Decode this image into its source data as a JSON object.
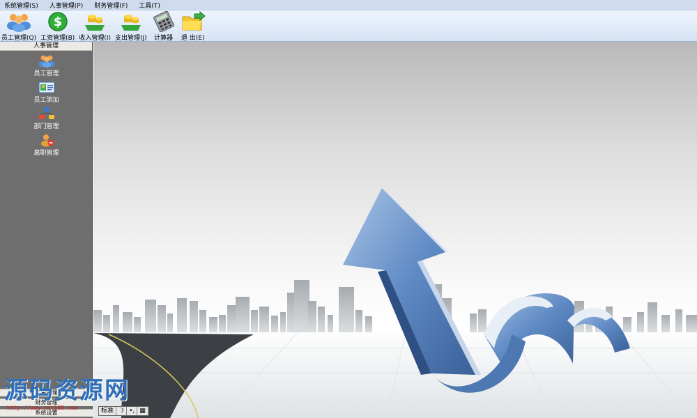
{
  "menu": [
    "系统管理(S)",
    "人事管理(P)",
    "财务管理(F)",
    "工具(T)"
  ],
  "toolbar": {
    "employee": "员工管理(Q)",
    "salary": "工资管理(B)",
    "income": "收入管理(I)",
    "expense": "支出管理(J)",
    "calculator": "计算器",
    "exit": "退 出(E)"
  },
  "sidebar": {
    "header": "人事管理",
    "items": [
      {
        "label": "员工管理",
        "icon": "users-icon"
      },
      {
        "label": "员工添加",
        "icon": "id-card-icon"
      },
      {
        "label": "部门管理",
        "icon": "org-chart-icon"
      },
      {
        "label": "离职管理",
        "icon": "user-remove-icon"
      }
    ],
    "bottom": [
      "工资管理",
      "财务管理",
      "系统设置"
    ]
  },
  "watermark": {
    "text": "源码资源网",
    "url": "http://www.net188.com"
  },
  "ime": [
    "标准",
    "☽",
    "•,",
    "▦"
  ],
  "colors": {
    "menubar": "#cfdcf0",
    "sidebar": "#6e6e6e",
    "arrow": "#5a86c0",
    "watermark": "#2f6fb8"
  }
}
